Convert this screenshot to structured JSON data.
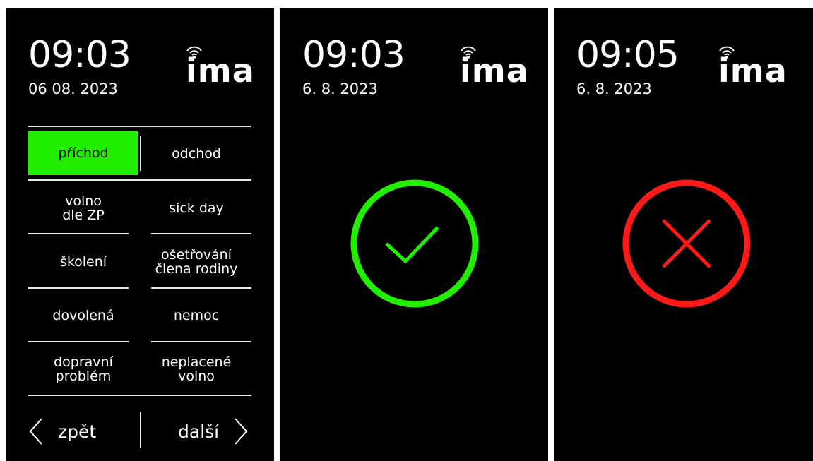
{
  "brand": "ima",
  "screens": [
    {
      "time": "09:03",
      "date": "06 08. 2023",
      "buttons": [
        {
          "label": "příchod",
          "name": "arrival-button"
        },
        {
          "label": "odchod",
          "name": "departure-button"
        },
        {
          "label": "volno\ndle ZP",
          "name": "leave-by-law-button"
        },
        {
          "label": "sick day",
          "name": "sick-day-button"
        },
        {
          "label": "školení",
          "name": "training-button"
        },
        {
          "label": "ošetřování\nčlena rodiny",
          "name": "family-care-button"
        },
        {
          "label": "dovolená",
          "name": "vacation-button"
        },
        {
          "label": "nemoc",
          "name": "illness-button"
        },
        {
          "label": "dopravní\nproblém",
          "name": "traffic-problem-button"
        },
        {
          "label": "neplacené\nvolno",
          "name": "unpaid-leave-button"
        }
      ],
      "back_label": "zpět",
      "next_label": "další"
    },
    {
      "time": "09:03",
      "date": "6. 8. 2023",
      "status_icon": "check-circle-icon"
    },
    {
      "time": "09:05",
      "date": "6. 8. 2023",
      "status_icon": "cross-circle-icon"
    }
  ],
  "colors": {
    "active": "#22ee00",
    "success": "#22ee00",
    "error": "#ff1a1a",
    "background": "#000000",
    "text": "#ffffff"
  }
}
